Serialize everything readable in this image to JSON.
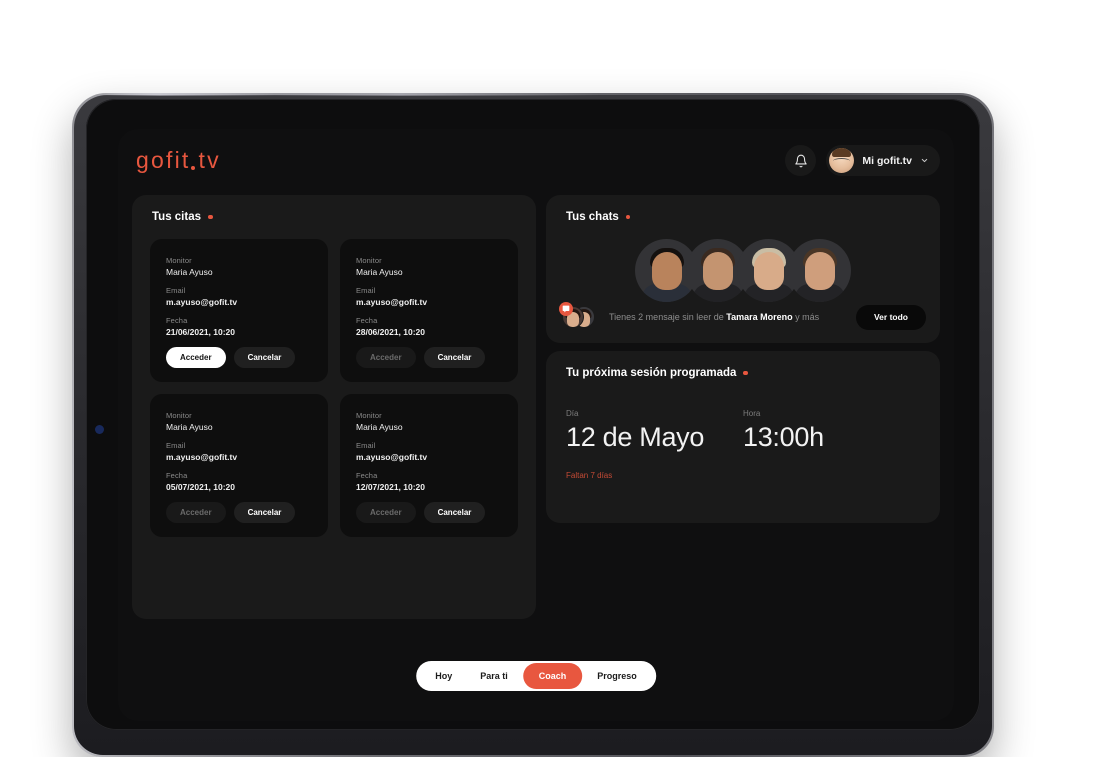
{
  "brand": {
    "logo_text_1": "gofit",
    "logo_text_2": "tv",
    "accent_color": "#e8573f"
  },
  "header": {
    "bell_icon": "bell-icon",
    "account_label": "Mi gofit.tv",
    "chevron_icon": "chevron-down-icon",
    "avatar_icon": "user-avatar"
  },
  "citas": {
    "title": "Tus citas",
    "labels": {
      "monitor": "Monitor",
      "email": "Email",
      "fecha": "Fecha"
    },
    "cards": [
      {
        "monitor": "Maria Ayuso",
        "email": "m.ayuso@gofit.tv",
        "fecha": "21/06/2021, 10:20",
        "primary_label": "Acceder",
        "primary_enabled": true,
        "secondary_label": "Cancelar"
      },
      {
        "monitor": "Maria Ayuso",
        "email": "m.ayuso@gofit.tv",
        "fecha": "28/06/2021, 10:20",
        "primary_label": "Acceder",
        "primary_enabled": false,
        "secondary_label": "Cancelar"
      },
      {
        "monitor": "Maria Ayuso",
        "email": "m.ayuso@gofit.tv",
        "fecha": "05/07/2021, 10:20",
        "primary_label": "Acceder",
        "primary_enabled": false,
        "secondary_label": "Cancelar"
      },
      {
        "monitor": "Maria Ayuso",
        "email": "m.ayuso@gofit.tv",
        "fecha": "12/07/2021, 10:20",
        "primary_label": "Acceder",
        "primary_enabled": false,
        "secondary_label": "Cancelar"
      }
    ]
  },
  "chats": {
    "title": "Tus chats",
    "message_prefix": "Tienes 2 mensaje sin leer de",
    "message_name": "Tamara Moreno",
    "message_suffix": "y más",
    "view_all_label": "Ver todo",
    "badge_icon": "chat-bubble-icon",
    "unread_count": 2
  },
  "sesion": {
    "title": "Tu próxima sesión programada",
    "day_label": "Día",
    "day_value": "12 de Mayo",
    "time_label": "Hora",
    "time_value": "13:00h",
    "countdown": "Faltan 7 días"
  },
  "tabbar": {
    "tabs": [
      {
        "label": "Hoy",
        "active": false
      },
      {
        "label": "Para ti",
        "active": false
      },
      {
        "label": "Coach",
        "active": true
      },
      {
        "label": "Progreso",
        "active": false
      }
    ]
  }
}
